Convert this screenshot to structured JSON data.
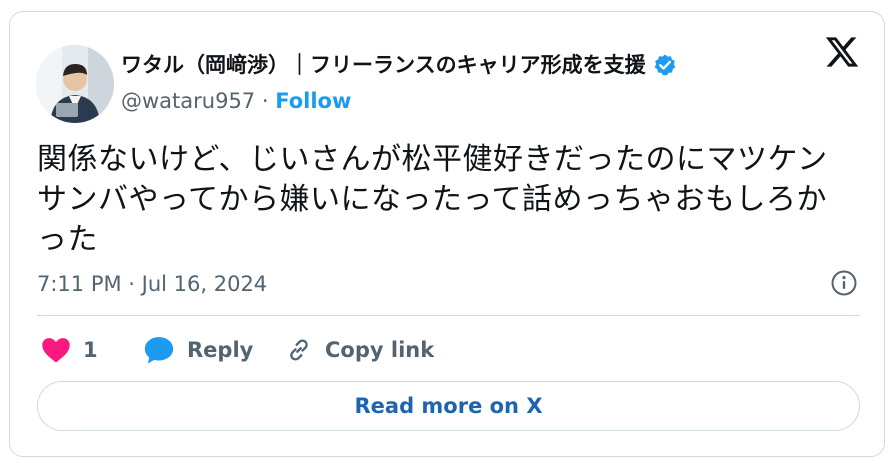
{
  "author": {
    "display_name": "ワタル（岡﨑渉）｜フリーランスのキャリア形成を支援",
    "handle": "@wataru957",
    "separator": " · ",
    "follow_label": "Follow"
  },
  "tweet": {
    "text": "関係ないけど、じいさんが松平健好きだったのにマツケンサンバやってから嫌いになったって話めっちゃおもしろかった",
    "timestamp": "7:11 PM · Jul 16, 2024"
  },
  "actions": {
    "like_count": "1",
    "reply_label": "Reply",
    "copy_label": "Copy link"
  },
  "cta": {
    "read_more_label": "Read more on X"
  },
  "colors": {
    "accent": "#1d9bf0",
    "like": "#f91880",
    "muted": "#536471",
    "border": "#cfd9de"
  },
  "icons": [
    "verified-badge-icon",
    "x-logo-icon",
    "info-icon",
    "heart-icon",
    "reply-bubble-icon",
    "link-icon"
  ]
}
